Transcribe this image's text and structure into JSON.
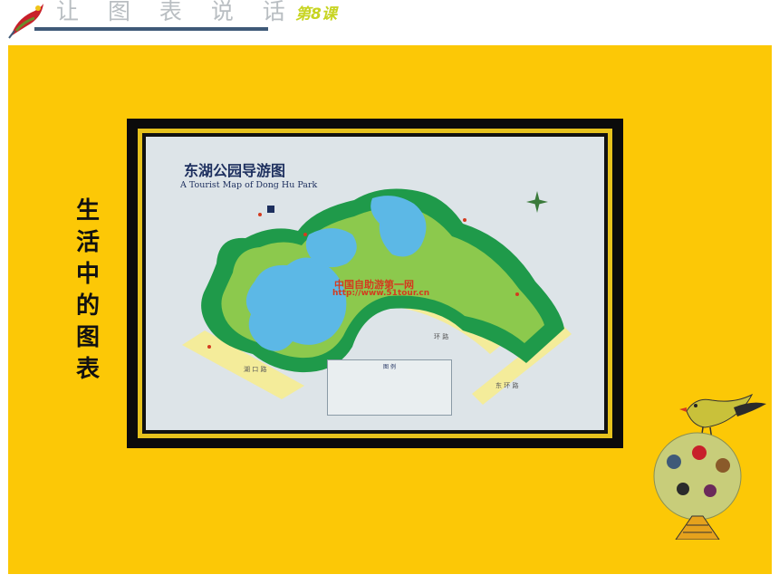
{
  "header": {
    "title": "让 图 表 说 话",
    "lesson": "第8课"
  },
  "panel": {
    "side_caption": "生活中的图表"
  },
  "map": {
    "title_cn": "东湖公园导游图",
    "title_en": "A Tourist Map of Dong Hu Park",
    "watermark_line1": "中国自助游第一网",
    "watermark_line2": "http://www.51tour.cn",
    "legend_title": "图 例",
    "road_labels": [
      "湖 口 路",
      "环 路",
      "东 环 路"
    ]
  },
  "colors": {
    "panel": "#fcc806",
    "frame_band": "#e6c21d",
    "park_green": "#1f9a4a",
    "lake_blue": "#5cb8e6",
    "road_yellow": "#f4ec9a"
  }
}
